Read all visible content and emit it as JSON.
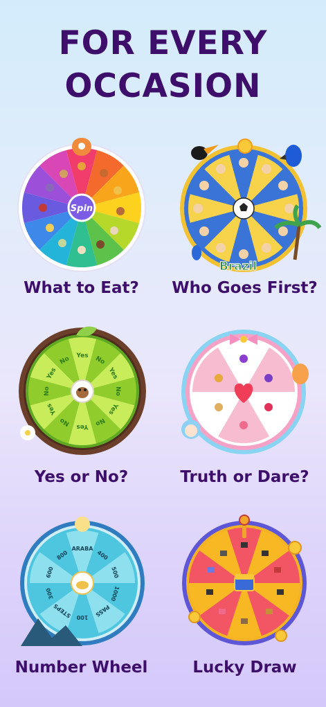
{
  "headline": {
    "line1": "FOR EVERY",
    "line2": "OCCASION"
  },
  "wheels": [
    {
      "caption": "What to Eat?",
      "center_label": "Spin"
    },
    {
      "caption": "Who Goes First?",
      "badge": "Brazil"
    },
    {
      "caption": "Yes or No?",
      "segment_labels": [
        "Yes",
        "No"
      ]
    },
    {
      "caption": "Truth or Dare?"
    },
    {
      "caption": "Number Wheel",
      "segment_labels": [
        "ARABA",
        "400",
        "500",
        "1000",
        "PASS",
        "100",
        "STEPS",
        "300",
        "600",
        "800"
      ]
    },
    {
      "caption": "Lucky Draw"
    }
  ],
  "colors": {
    "title": "#3d0f6a",
    "rainbow": [
      "#f03d6b",
      "#f36a2c",
      "#f9a51b",
      "#fcd21f",
      "#b5d82a",
      "#5cc24a",
      "#2fbf91",
      "#24b3d9",
      "#3d88e8",
      "#6a5ae0",
      "#9c4fd8",
      "#d946b5"
    ],
    "soccer": [
      "#3a74d6",
      "#f6d34a"
    ],
    "yesno": [
      "#c9ec5b",
      "#8fcc2c"
    ],
    "truthdare": [
      "#ffffff",
      "#f7bcd0"
    ],
    "number": [
      "#8fe0ef",
      "#4ec6e0"
    ],
    "lucky": [
      "#f25563",
      "#f8b824"
    ]
  },
  "icons": [
    "food-icons",
    "avatar-icons",
    "sparrow-icon",
    "heart-icon",
    "cat-rider-icon",
    "treasure-chest-icon"
  ]
}
